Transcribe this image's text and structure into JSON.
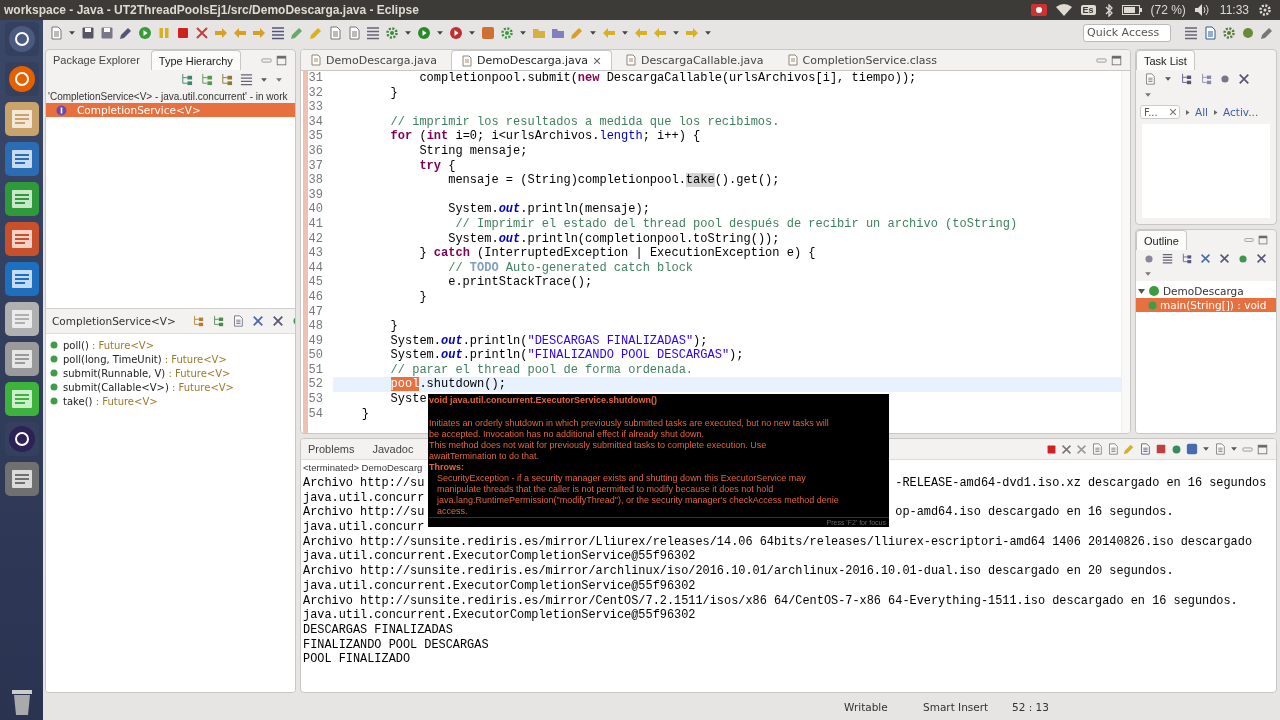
{
  "top_panel": {
    "title": "workspace - Java - UT2ThreadPoolsEj1/src/DemoDescarga.java - Eclipse",
    "keyboard_layout": "Es",
    "battery": "(72 %)",
    "clock": "11:33"
  },
  "toolbar": {
    "quick_access": {
      "placeholder": "Quick Access"
    }
  },
  "left_panel": {
    "tabs": [
      {
        "label": "Package Explorer",
        "selected": false
      },
      {
        "label": "Type Hierarchy",
        "selected": true
      }
    ],
    "hierarchy_title": "'CompletionService<V> - java.util.concurrent' - in work",
    "tree": [
      {
        "label": "CompletionService<V>",
        "selected": true
      }
    ],
    "members_title": "CompletionService<V>",
    "members": [
      {
        "name": "poll()",
        "type": ": Future<V>"
      },
      {
        "name": "poll(long, TimeUnit)",
        "type": ": Future<V>"
      },
      {
        "name": "submit(Runnable, V)",
        "type": ": Future<V>"
      },
      {
        "name": "submit(Callable<V>)",
        "type": ": Future<V>"
      },
      {
        "name": "take()",
        "type": ": Future<V>"
      }
    ]
  },
  "editor": {
    "tabs": [
      {
        "label": "DemoDescarga.java",
        "selected": false
      },
      {
        "label": "DemoDescarga.java",
        "selected": true
      },
      {
        "label": "DescargaCallable.java",
        "selected": false
      },
      {
        "label": "CompletionService.class",
        "selected": false
      }
    ],
    "lines": [
      {
        "number": "31",
        "current": false,
        "segments": [
          {
            "kind": "code",
            "text": "            completionpool.submit("
          },
          {
            "kind": "keyword",
            "text": "new"
          },
          {
            "kind": "code",
            "text": " DescargaCallable(urlsArchivos[i], tiempo));"
          }
        ]
      },
      {
        "number": "32",
        "current": false,
        "segments": [
          {
            "kind": "code",
            "text": "        }"
          }
        ]
      },
      {
        "number": "33",
        "current": false
      },
      {
        "number": "34",
        "current": false,
        "segments": [
          {
            "kind": "comment",
            "text": "        // imprimir los resultados a medida que los recibimos."
          }
        ]
      },
      {
        "number": "35",
        "current": false,
        "segments": [
          {
            "kind": "keyword",
            "text": "        for"
          },
          {
            "kind": "code",
            "text": " ("
          },
          {
            "kind": "keyword",
            "text": "int"
          },
          {
            "kind": "code",
            "text": " i=0; i<urlsArchivos."
          },
          {
            "kind": "member",
            "text": "length"
          },
          {
            "kind": "code",
            "text": "; i++) {"
          }
        ]
      },
      {
        "number": "36",
        "current": false,
        "segments": [
          {
            "kind": "code",
            "text": "            String mensaje;"
          }
        ]
      },
      {
        "number": "37",
        "current": false,
        "segments": [
          {
            "kind": "keyword",
            "text": "            try"
          },
          {
            "kind": "code",
            "text": " {"
          }
        ]
      },
      {
        "number": "38",
        "current": false,
        "segments": [
          {
            "kind": "code",
            "text": "                mensaje = (String)completionpool."
          },
          {
            "kind": "occurrence",
            "text": "take"
          },
          {
            "kind": "code",
            "text": "().get();"
          }
        ]
      },
      {
        "number": "39",
        "current": false
      },
      {
        "number": "40",
        "current": false,
        "segments": [
          {
            "kind": "code",
            "text": "                System."
          },
          {
            "kind": "static",
            "text": "out"
          },
          {
            "kind": "code",
            "text": ".println(mensaje);"
          }
        ]
      },
      {
        "number": "41",
        "current": false,
        "segments": [
          {
            "kind": "comment",
            "text": "                 // Imprimir el estado del thread pool después de recibir un archivo (toString)"
          }
        ]
      },
      {
        "number": "42",
        "current": false,
        "segments": [
          {
            "kind": "code",
            "text": "                System."
          },
          {
            "kind": "static",
            "text": "out"
          },
          {
            "kind": "code",
            "text": ".println(completionpool.toString());"
          }
        ]
      },
      {
        "number": "43",
        "current": false,
        "segments": [
          {
            "kind": "code",
            "text": "            } "
          },
          {
            "kind": "keyword",
            "text": "catch"
          },
          {
            "kind": "code",
            "text": " (InterruptedException | ExecutionException e) {"
          }
        ]
      },
      {
        "number": "44",
        "current": false,
        "segments": [
          {
            "kind": "comment",
            "text": "                // "
          },
          {
            "kind": "todo",
            "text": "TODO"
          },
          {
            "kind": "comment",
            "text": " Auto-generated catch block"
          }
        ]
      },
      {
        "number": "45",
        "current": false,
        "segments": [
          {
            "kind": "code",
            "text": "                e.printStackTrace();"
          }
        ]
      },
      {
        "number": "46",
        "current": false,
        "segments": [
          {
            "kind": "code",
            "text": "            }"
          }
        ]
      },
      {
        "number": "47",
        "current": false
      },
      {
        "number": "48",
        "current": false,
        "segments": [
          {
            "kind": "code",
            "text": "        }"
          }
        ]
      },
      {
        "number": "49",
        "current": false,
        "segments": [
          {
            "kind": "code",
            "text": "        System."
          },
          {
            "kind": "static",
            "text": "out"
          },
          {
            "kind": "code",
            "text": ".println("
          },
          {
            "kind": "string",
            "text": "\"DESCARGAS FINALIZADAS\""
          },
          {
            "kind": "code",
            "text": ");"
          }
        ]
      },
      {
        "number": "50",
        "current": false,
        "segments": [
          {
            "kind": "code",
            "text": "        System."
          },
          {
            "kind": "static",
            "text": "out"
          },
          {
            "kind": "code",
            "text": ".println("
          },
          {
            "kind": "string",
            "text": "\"FINALIZANDO POOL DESCARGAS\""
          },
          {
            "kind": "code",
            "text": ");"
          }
        ]
      },
      {
        "number": "51",
        "current": false,
        "segments": [
          {
            "kind": "comment",
            "text": "        // parar el thread pool de forma ordenada."
          }
        ]
      },
      {
        "number": "52",
        "current": true,
        "segments": [
          {
            "kind": "selection",
            "text": "        pool"
          },
          {
            "kind": "code",
            "text": ".shutdown();"
          }
        ]
      },
      {
        "number": "53",
        "current": false,
        "segments": [
          {
            "kind": "code",
            "text": "        Syste"
          }
        ]
      },
      {
        "number": "54",
        "current": false,
        "segments": [
          {
            "kind": "code",
            "text": "    }"
          }
        ]
      }
    ]
  },
  "tooltip": {
    "signature": "void java.util.concurrent.ExecutorService.shutdown()",
    "paragraphs": [
      [
        "Initiates an orderly shutdown in which previously submitted tasks are executed, but no new tasks will",
        " be accepted. Invocation has no additional effect if already shut down."
      ],
      [
        "This method does not wait for previously submitted tasks to complete execution. Use",
        " awaitTermination to do that."
      ]
    ],
    "throws_label": "Throws:",
    "throws_lines": [
      "SecurityException - if a security manager exists and shutting down this ExecutorService may",
      " manipulate threads that the caller is not permitted to modify because it does not hold",
      "java.lang.RuntimePermission(\"modifyThread\"), or the security manager's checkAccess method denie",
      "access."
    ],
    "footer": "Press 'F2' for focus"
  },
  "task_list": {
    "tab": "Task List",
    "filter": {
      "placeholder": "F..."
    },
    "links": [
      "All",
      "Activ..."
    ]
  },
  "outline": {
    "tab": "Outline",
    "tree": [
      {
        "label": "DemoDescarga",
        "expanded": true,
        "selected": false,
        "children": [
          {
            "label": "main(String[]) : void",
            "selected": true
          }
        ]
      }
    ]
  },
  "console": {
    "tabs": [
      {
        "label": "Problems",
        "selected": false
      },
      {
        "label": "Javadoc",
        "selected": false
      }
    ],
    "header": "<terminated> DemoDescarg",
    "lines": [
      {
        "text": "Archivo http://su",
        "tail": "-RELEASE-amd64-dvd1.iso.xz descargado en 16 segundos"
      },
      {
        "text": "java.util.concurr"
      },
      {
        "text": "Archivo http://su",
        "tail": "op-amd64.iso descargado en 16 segundos."
      },
      {
        "text": "java.util.concurr"
      },
      {
        "text": "Archivo http://sunsite.rediris.es/mirror/Lliurex/releases/14.06 64bits/releases/lliurex-escriptori-amd64 1406 20140826.iso descargado"
      },
      {
        "text": "java.util.concurrent.ExecutorCompletionService@55f96302"
      },
      {
        "text": "Archivo http://sunsite.rediris.es/mirror/archlinux/iso/2016.10.01/archlinux-2016.10.01-dual.iso descargado en 20 segundos."
      },
      {
        "text": "java.util.concurrent.ExecutorCompletionService@55f96302"
      },
      {
        "text": "Archivo http://sunsite.rediris.es/mirror/CentOS/7.2.1511/isos/x86 64/CentOS-7-x86 64-Everything-1511.iso descargado en 16 segundos."
      },
      {
        "text": "java.util.concurrent.ExecutorCompletionService@55f96302"
      },
      {
        "text": "DESCARGAS FINALIZADAS"
      },
      {
        "text": "FINALIZANDO POOL DESCARGAS"
      },
      {
        "text": "POOL FINALIZADO"
      }
    ]
  },
  "status_bar": {
    "mode": "Writable",
    "insert": "Smart Insert",
    "position": "52 : 13"
  }
}
